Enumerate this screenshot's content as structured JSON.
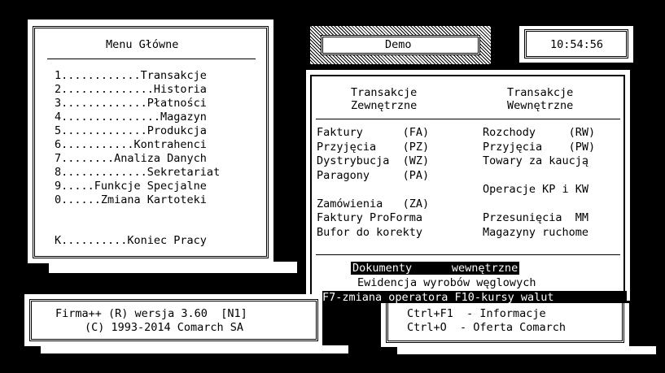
{
  "menu": {
    "title": "Menu Główne",
    "items": [
      "1............Transakcje",
      "2..............Historia",
      "3.............Płatności",
      "4...............Magazyn",
      "5.............Produkcja",
      "6...........Kontrahenci",
      "7........Analiza Danych",
      "8.............Sekretariat",
      "9.....Funkcje Specjalne",
      "0......Zmiana Kartoteki"
    ],
    "exit": "K..........Koniec Pracy"
  },
  "header": {
    "company": "Demo",
    "clock": "10:54:56"
  },
  "transactions": {
    "external_head": [
      "Transakcje",
      "Zewnętrzne"
    ],
    "internal_head": [
      "Transakcje",
      "Wewnętrzne"
    ],
    "left": [
      "Faktury      (FA)",
      "Przyjęcia    (PZ)",
      "Dystrybucja  (WZ)",
      "Paragony     (PA)",
      "",
      "Zamówienia   (ZA)",
      "Faktury ProForma",
      "Bufor do korekty"
    ],
    "right": [
      "Rozchody     (RW)",
      "Przyjęcia    (PW)",
      "Towary za kaucją",
      "",
      "Operacje KP i KW",
      "",
      "Przesunięcia  MM",
      "Magazyny ruchome"
    ]
  },
  "bottom_menu": {
    "selected": "Dokumenty      wewnętrzne",
    "coal": "Ewidencja wyrobów węglowych",
    "hotkeys": "F7-zmiana operatora F10-kursy walut"
  },
  "footer": {
    "version": "Firma++ (R) wersja 3.60  [N1]",
    "copyright": "(C) 1993-2014 Comarch SA",
    "help1": "Ctrl+F1  - Informacje",
    "help2": "Ctrl+O  - Oferta Comarch"
  }
}
